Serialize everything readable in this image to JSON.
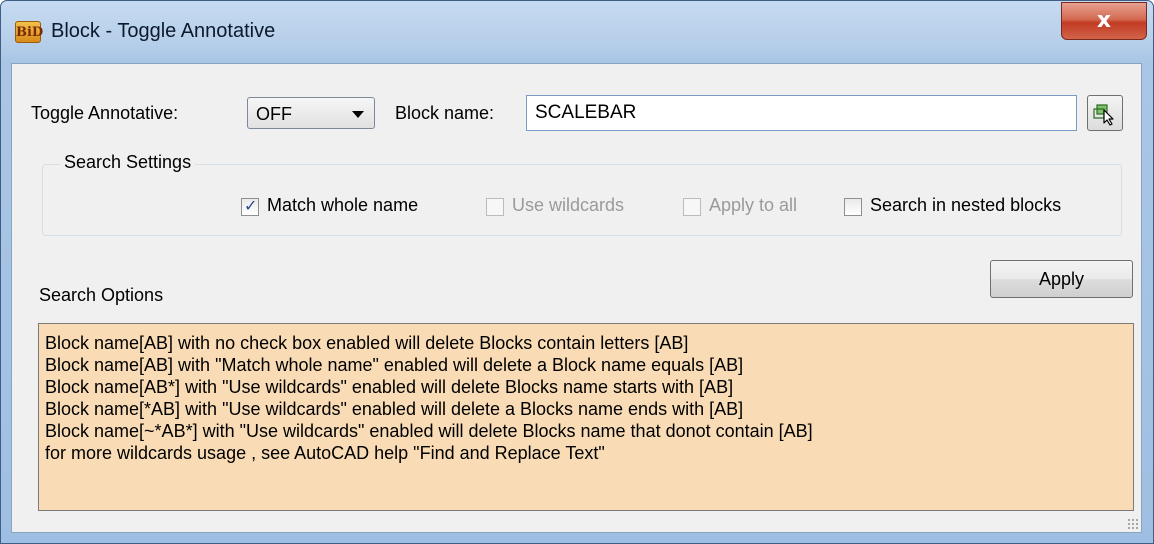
{
  "window": {
    "title": "Block - Toggle Annotative",
    "app_icon_text": "BiD",
    "close_label": "x"
  },
  "toggle": {
    "label": "Toggle Annotative:",
    "selected": "OFF"
  },
  "block_name": {
    "label": "Block name:",
    "value": "SCALEBAR"
  },
  "search_settings": {
    "title": "Search Settings",
    "checkboxes": [
      {
        "label": "Match whole name",
        "checked": true,
        "enabled": true
      },
      {
        "label": "Use wildcards",
        "checked": false,
        "enabled": false
      },
      {
        "label": "Apply to all",
        "checked": false,
        "enabled": false
      },
      {
        "label": "Search in nested blocks",
        "checked": false,
        "enabled": true
      }
    ]
  },
  "search_options": {
    "title": "Search Options",
    "apply_label": "Apply",
    "lines": [
      "Block name[AB] with no check box enabled will delete  Blocks contain letters [AB]",
      "Block name[AB] with \"Match whole name\" enabled will delete a Block name equals [AB]",
      "Block name[AB*] with \"Use wildcards\" enabled will delete  Blocks name starts with [AB]",
      "Block name[*AB] with \"Use wildcards\" enabled will delete a Blocks name ends with [AB]",
      "Block name[~*AB*] with \"Use wildcards\" enabled will delete Blocks name that donot contain [AB]",
      "for more wildcards usage , see AutoCAD help  \"Find and Replace Text\""
    ]
  },
  "icons": {
    "app": "bid-app-icon",
    "close": "close-icon",
    "pick": "pick-block-icon",
    "dropdown": "chevron-down-icon",
    "check": "checkmark-icon"
  },
  "colors": {
    "info_background": "#f9dcb5",
    "close_button": "#c13b22",
    "titlebar": "#b7cfea"
  }
}
